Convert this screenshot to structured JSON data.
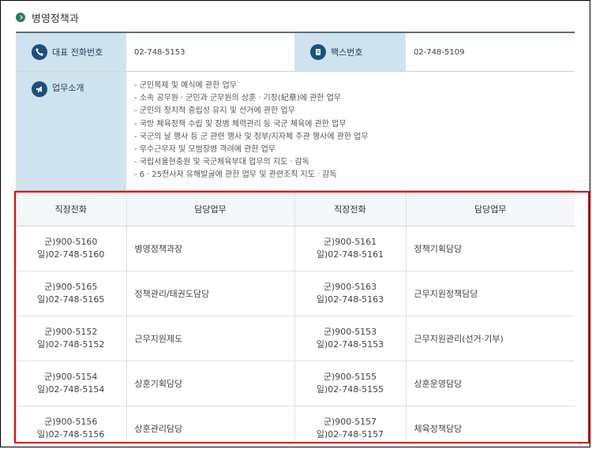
{
  "section": {
    "title": "병영정책과"
  },
  "info": {
    "phone_label": "대표 전화번호",
    "phone_value": "02-748-5153",
    "fax_label": "팩스번호",
    "fax_value": "02-748-5109",
    "duties_label": "업무소개",
    "duties": [
      "- 군인복제 및 예식에 관한 업무",
      "- 소속 공무원ㆍ군인과 군무원의 상훈ㆍ기장(紀章)에 관한 업무",
      "- 군인의 정치적 중립성 유지 및 선거에 관한 업무",
      "- 국방 체육정책 수립 및 장병 체력관리 등 국군 체육에 관한 업무",
      "- 국군의 날 행사 등 군 관련 행사 및 정부/지자체 주관 행사에 관한 업무",
      "- 우수근무자 및 모범장병 격려에 관한 업무",
      "- 국립서울현충원 및 국군체육부대 업무의 지도ㆍ감독",
      "- 6ㆍ25전사자 유해발굴에 관한 업무 및 관련조직 지도ㆍ감독"
    ]
  },
  "staff": {
    "headers": [
      "직장전화",
      "담당업무",
      "직장전화",
      "담당업무"
    ],
    "rows": [
      {
        "l_mil": "군)900-5160",
        "l_gen": "일)02-748-5160",
        "l_duty": "병영정책과장",
        "r_mil": "군)900-5161",
        "r_gen": "일)02-748-5161",
        "r_duty": "정책기획담당"
      },
      {
        "l_mil": "군)900-5165",
        "l_gen": "일)02-748-5165",
        "l_duty": "정책관리/태권도담당",
        "r_mil": "군)900-5163",
        "r_gen": "일)02-748-5163",
        "r_duty": "근무지원정책담당"
      },
      {
        "l_mil": "군)900-5152",
        "l_gen": "일)02-748-5152",
        "l_duty": "근무지원제도",
        "r_mil": "군)900-5153",
        "r_gen": "일)02-748-5153",
        "r_duty": "근무지원관리(선거·기부)"
      },
      {
        "l_mil": "군)900-5154",
        "l_gen": "일)02-748-5154",
        "l_duty": "상훈기획담당",
        "r_mil": "군)900-5155",
        "r_gen": "일)02-748-5155",
        "r_duty": "상훈운영담당"
      },
      {
        "l_mil": "군)900-5156",
        "l_gen": "일)02-748-5156",
        "l_duty": "상훈관리담당",
        "r_mil": "군)900-5157",
        "r_gen": "일)02-748-5157",
        "r_duty": "체육정책담당"
      }
    ]
  },
  "colors": {
    "accent": "#2c7a5a",
    "label_bg": "#cfe3ee",
    "icon": "#1c4f7f",
    "highlight_border": "#e60000"
  },
  "icons": [
    "chevron-right-icon",
    "phone-icon",
    "fax-icon",
    "megaphone-icon"
  ]
}
